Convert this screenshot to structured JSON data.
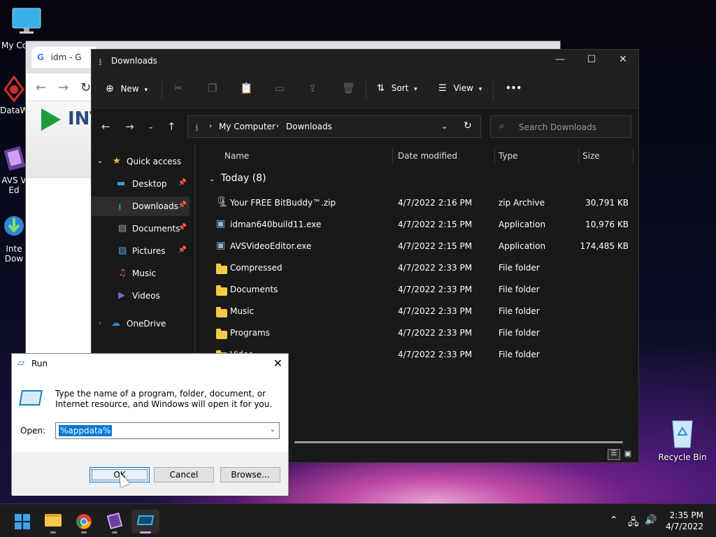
{
  "desktop": {
    "icons": [
      {
        "label": "My Co",
        "icon": "monitor-icon"
      },
      {
        "label": "DataW",
        "icon": "datawatch-icon"
      },
      {
        "label": "AVS V\nEd",
        "icon": "film-icon"
      },
      {
        "label": "Inte\nDow",
        "icon": "idm-icon"
      },
      {
        "label": "Recycle Bin",
        "icon": "recycle-bin-icon"
      }
    ]
  },
  "chrome": {
    "tab_title": "idm - G",
    "banner_text": "INT"
  },
  "explorer": {
    "title": "Downloads",
    "toolbar": {
      "new_label": "New",
      "sort_label": "Sort",
      "view_label": "View",
      "more_label": "•••"
    },
    "address": {
      "crumbs": [
        "My Computer",
        "Downloads"
      ]
    },
    "search_placeholder": "Search Downloads",
    "nav": {
      "quick_access": "Quick access",
      "items": [
        {
          "label": "Desktop",
          "pinned": true,
          "color": "#3aa0e0"
        },
        {
          "label": "Downloads",
          "pinned": true,
          "color": "#3cb371"
        },
        {
          "label": "Documents",
          "pinned": true,
          "color": "#9aa4b1"
        },
        {
          "label": "Pictures",
          "pinned": true,
          "color": "#4aa3df"
        },
        {
          "label": "Music",
          "pinned": false,
          "color": "#e86a4b"
        },
        {
          "label": "Videos",
          "pinned": false,
          "color": "#8a5cc7"
        }
      ],
      "onedrive": "OneDrive"
    },
    "columns": [
      "Name",
      "Date modified",
      "Type",
      "Size"
    ],
    "group_label": "Today (8)",
    "files": [
      {
        "name": "Your FREE BitBuddy™.zip",
        "date": "4/7/2022 2:16 PM",
        "type": "zip Archive",
        "size": "30,791 KB",
        "kind": "zip"
      },
      {
        "name": "idman640build11.exe",
        "date": "4/7/2022 2:15 PM",
        "type": "Application",
        "size": "10,976 KB",
        "kind": "exe"
      },
      {
        "name": "AVSVideoEditor.exe",
        "date": "4/7/2022 2:15 PM",
        "type": "Application",
        "size": "174,485 KB",
        "kind": "exe"
      },
      {
        "name": "Compressed",
        "date": "4/7/2022 2:33 PM",
        "type": "File folder",
        "size": "",
        "kind": "folder"
      },
      {
        "name": "Documents",
        "date": "4/7/2022 2:33 PM",
        "type": "File folder",
        "size": "",
        "kind": "folder"
      },
      {
        "name": "Music",
        "date": "4/7/2022 2:33 PM",
        "type": "File folder",
        "size": "",
        "kind": "folder"
      },
      {
        "name": "Programs",
        "date": "4/7/2022 2:33 PM",
        "type": "File folder",
        "size": "",
        "kind": "folder"
      },
      {
        "name": "Video",
        "date": "4/7/2022 2:33 PM",
        "type": "File folder",
        "size": "",
        "kind": "folder"
      }
    ]
  },
  "run": {
    "title": "Run",
    "description": "Type the name of a program, folder, document, or Internet resource, and Windows will open it for you.",
    "open_label": "Open:",
    "value": "%appdata%",
    "ok_label": "OK",
    "cancel_label": "Cancel",
    "browse_label": "Browse..."
  },
  "taskbar": {
    "time": "2:35 PM",
    "date": "4/7/2022"
  }
}
